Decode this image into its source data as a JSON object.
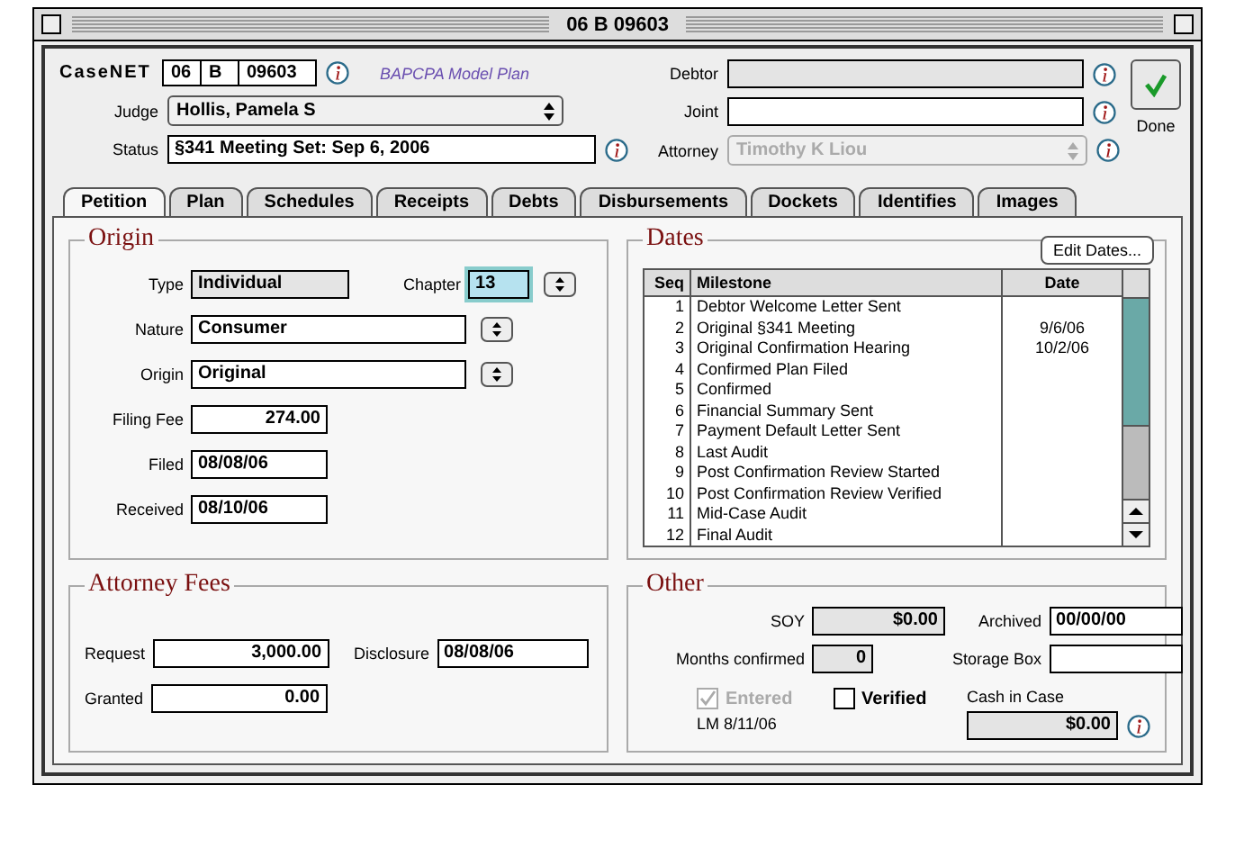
{
  "window": {
    "title": "06 B 09603"
  },
  "header": {
    "logo": "CaseNET",
    "case_parts": [
      "06",
      "B",
      "09603"
    ],
    "plan": "BAPCPA Model Plan",
    "judge_label": "Judge",
    "judge": "Hollis, Pamela S",
    "status_label": "Status",
    "status": "§341 Meeting Set:  Sep 6, 2006",
    "debtor_label": "Debtor",
    "joint_label": "Joint",
    "attorney_label": "Attorney",
    "attorney": "Timothy K Liou",
    "attorney_disabled": true,
    "done": "Done"
  },
  "tabs": [
    {
      "label": "Petition",
      "selected": true
    },
    {
      "label": "Plan",
      "selected": false
    },
    {
      "label": "Schedules",
      "selected": false
    },
    {
      "label": "Receipts",
      "selected": false
    },
    {
      "label": "Debts",
      "selected": false
    },
    {
      "label": "Disbursements",
      "selected": false
    },
    {
      "label": "Dockets",
      "selected": false
    },
    {
      "label": "Identifies",
      "selected": false
    },
    {
      "label": "Images",
      "selected": false
    }
  ],
  "origin": {
    "title": "Origin",
    "type_label": "Type",
    "type": "Individual",
    "chapter_label": "Chapter",
    "chapter": "13",
    "nature_label": "Nature",
    "nature": "Consumer",
    "origin_label": "Origin",
    "origin": "Original",
    "filing_fee_label": "Filing Fee",
    "filing_fee": "274.00",
    "filed_label": "Filed",
    "filed": "08/08/06",
    "received_label": "Received",
    "received": "08/10/06"
  },
  "dates": {
    "title": "Dates",
    "edit_button": "Edit Dates...",
    "columns": [
      "Seq",
      "Milestone",
      "Date"
    ],
    "rows": [
      [
        "1",
        "Debtor Welcome Letter Sent",
        ""
      ],
      [
        "2",
        "Original §341 Meeting",
        "9/6/06"
      ],
      [
        "3",
        "Original Confirmation Hearing",
        "10/2/06"
      ],
      [
        "4",
        "Confirmed Plan Filed",
        ""
      ],
      [
        "5",
        "Confirmed",
        ""
      ],
      [
        "6",
        "Financial Summary Sent",
        ""
      ],
      [
        "7",
        "Payment Default Letter Sent",
        ""
      ],
      [
        "8",
        "Last Audit",
        ""
      ],
      [
        "9",
        "Post Confirmation Review Started",
        ""
      ],
      [
        "10",
        "Post Confirmation Review Verified",
        ""
      ],
      [
        "11",
        "Mid-Case Audit",
        ""
      ],
      [
        "12",
        "Final Audit",
        ""
      ]
    ]
  },
  "attorney_fees": {
    "title": "Attorney Fees",
    "request_label": "Request",
    "request": "3,000.00",
    "disclosure_label": "Disclosure",
    "disclosure": "08/08/06",
    "granted_label": "Granted",
    "granted": "0.00"
  },
  "other": {
    "title": "Other",
    "soy_label": "SOY",
    "soy": "$0.00",
    "archived_label": "Archived",
    "archived": "00/00/00",
    "months_label": "Months confirmed",
    "months": "0",
    "storage_label": "Storage Box",
    "entered": {
      "label": "Entered",
      "checked": true,
      "disabled": true
    },
    "verified": {
      "label": "Verified",
      "checked": false,
      "disabled": false
    },
    "lm": "LM  8/11/06",
    "cash_label": "Cash in Case",
    "cash": "$0.00"
  }
}
